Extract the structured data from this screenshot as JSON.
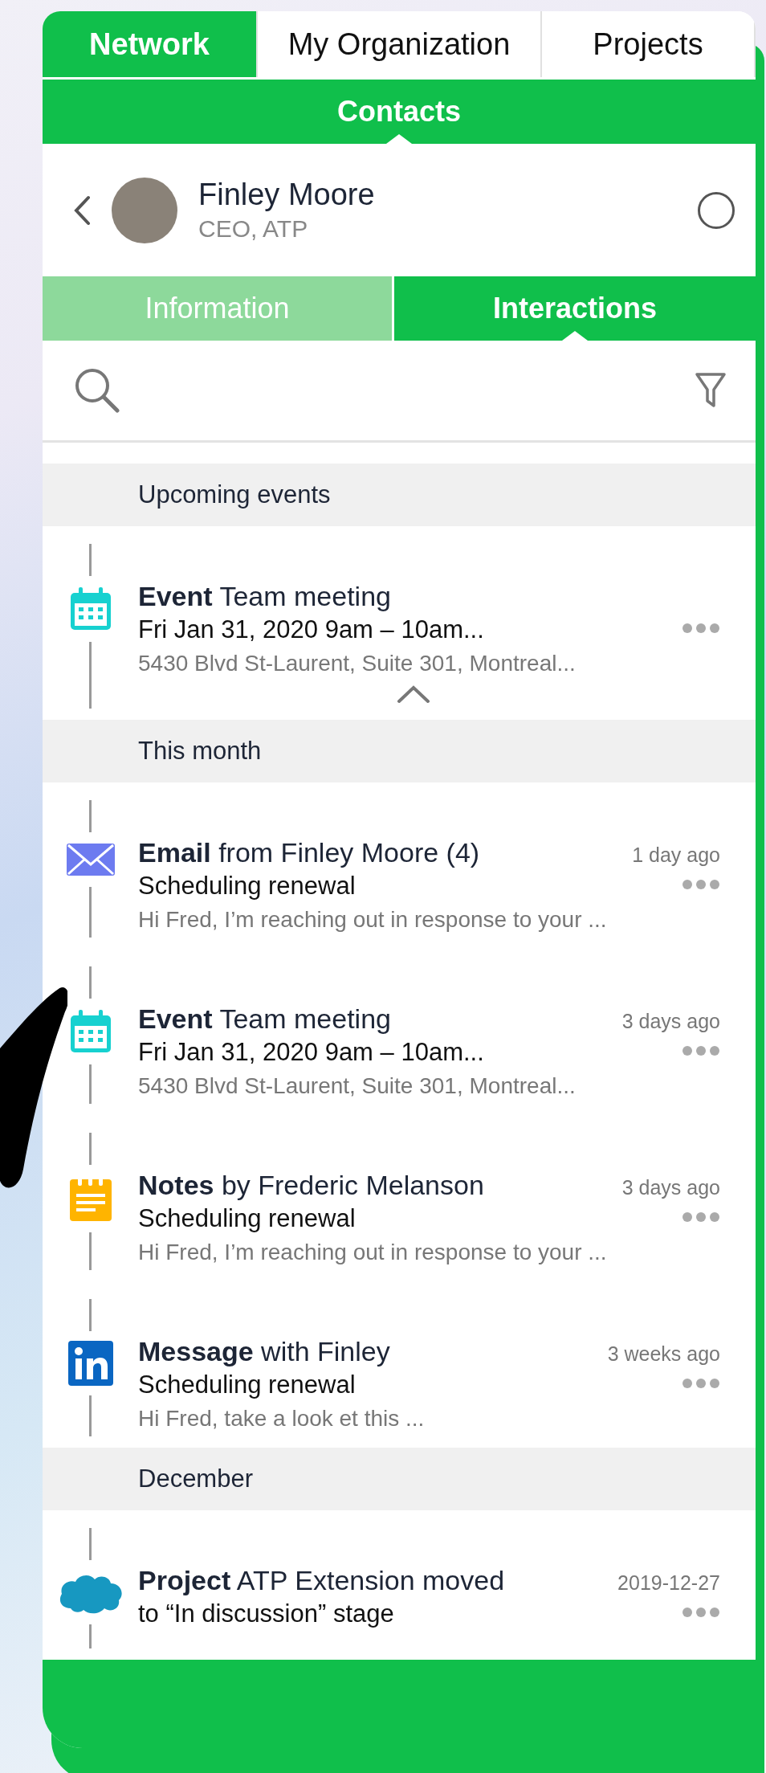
{
  "top_tabs": [
    {
      "label": "Network",
      "selected": true
    },
    {
      "label": "My Organization",
      "selected": false
    },
    {
      "label": "Projects",
      "selected": false
    }
  ],
  "section_bar": {
    "title": "Contacts"
  },
  "contact": {
    "name": "Finley Moore",
    "subtitle": "CEO, ATP",
    "selected": false
  },
  "detail_tabs": [
    {
      "label": "Information",
      "selected": false
    },
    {
      "label": "Interactions",
      "selected": true
    }
  ],
  "timeline": [
    {
      "title": "Upcoming events",
      "items": [
        {
          "kind": "event",
          "title": "**Event** Team meeting",
          "line2": "Fri Jan 31, 2020 9am – 10am...",
          "line3": "5430 Blvd St-Laurent, Suite 301, Montreal..."
        }
      ]
    },
    {
      "title": "This month",
      "items": [
        {
          "kind": "email",
          "title": "**Email** from Finley Moore (4)",
          "time": "1 day ago",
          "line2": "Scheduling renewal",
          "line3": "Hi Fred, I’m reaching out in response to your ..."
        },
        {
          "kind": "event",
          "title": "**Event** Team meeting",
          "time": "3 days ago",
          "line2": "Fri Jan 31, 2020 9am – 10am...",
          "line3": "5430 Blvd St-Laurent, Suite 301, Montreal..."
        },
        {
          "kind": "notes",
          "title": "**Notes** by Frederic Melanson",
          "time": "3 days ago",
          "line2": "Scheduling renewal",
          "line3": "Hi Fred, I’m reaching out in response to your ..."
        },
        {
          "kind": "message",
          "title": "**Message** with Finley",
          "time": "3 weeks ago",
          "line2": "Scheduling renewal",
          "line3": "Hi Fred, take a look et this ..."
        }
      ]
    },
    {
      "title": "December",
      "items": [
        {
          "kind": "project",
          "title": "**Project** ATP Extension moved",
          "time": "2019-12-27",
          "line2": "to “In discussion” stage"
        }
      ]
    }
  ]
}
